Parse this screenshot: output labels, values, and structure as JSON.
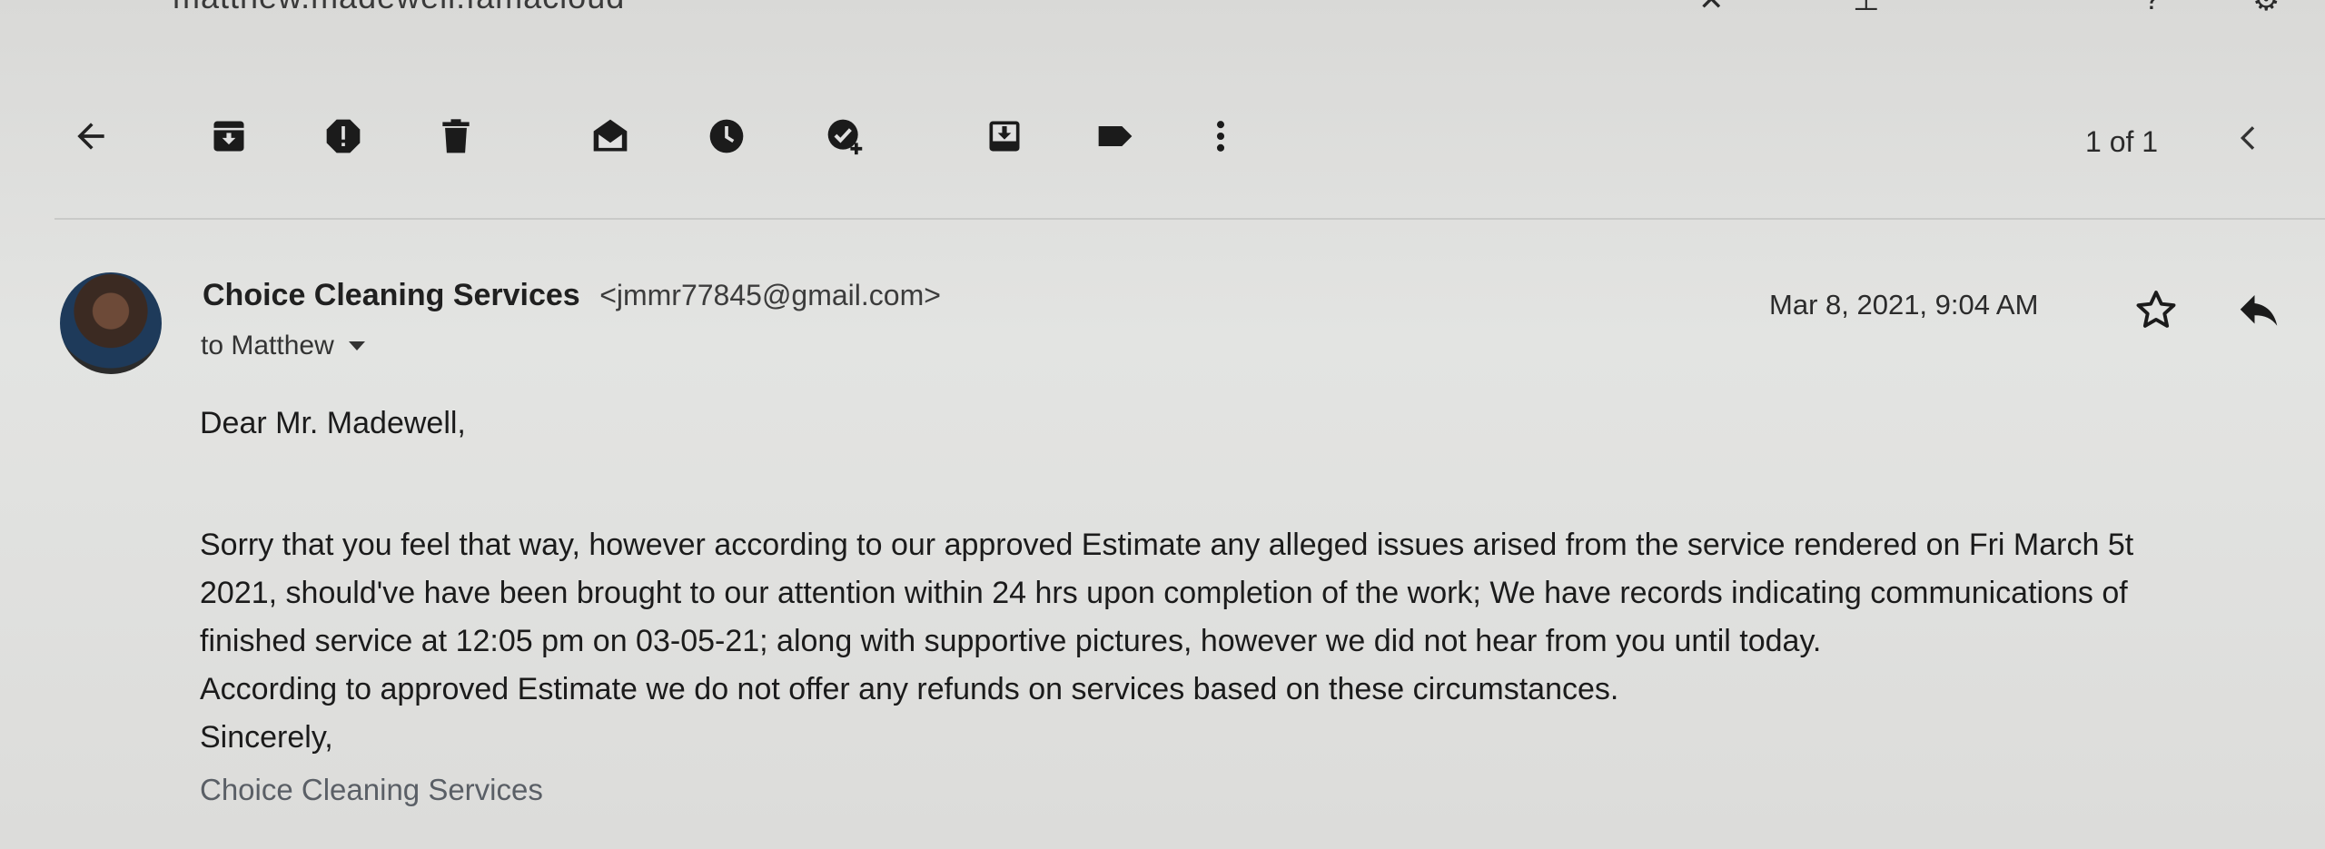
{
  "top_strip": {
    "address_fragment": "matthew.madewell.famacloud",
    "icons": [
      "close-icon",
      "tune-icon",
      "help-icon",
      "settings-icon"
    ]
  },
  "toolbar": {
    "icons": [
      "back-arrow-icon",
      "archive-icon",
      "report-spam-icon",
      "delete-icon",
      "mark-unread-icon",
      "snooze-icon",
      "add-task-icon",
      "move-to-icon",
      "label-icon",
      "more-vert-icon"
    ],
    "pager": "1 of 1"
  },
  "message": {
    "sender_name": "Choice Cleaning Services",
    "sender_email": "<jmmr77845@gmail.com>",
    "recipient": "to Matthew",
    "date": "Mar 8, 2021, 9:04 AM",
    "greeting": "Dear Mr. Madewell,",
    "lines": [
      "Sorry that you feel that way, however according to our approved Estimate any alleged issues arised from the service rendered on Fri March 5t",
      "2021, should've have been brought to our attention within 24 hrs upon completion of the work; We have records indicating communications of",
      "finished service at 12:05 pm on 03-05-21; along with supportive pictures, however we did not hear from you until today.",
      "According to approved Estimate we do not offer any refunds on services based on these circumstances."
    ],
    "closing": "Sincerely,",
    "signature": "Choice Cleaning Services"
  }
}
